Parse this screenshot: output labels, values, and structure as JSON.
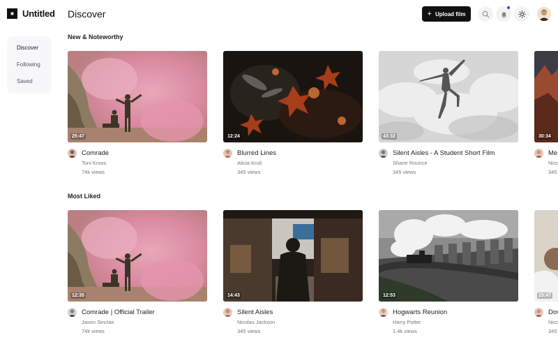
{
  "app": {
    "name": "Untitled"
  },
  "sidebar": {
    "items": [
      {
        "label": "Discover",
        "active": true
      },
      {
        "label": "Following",
        "active": false
      },
      {
        "label": "Saved",
        "active": false
      }
    ]
  },
  "header": {
    "title": "Discover",
    "upload_label": "Upload film",
    "icons": [
      "search-icon",
      "bell-icon",
      "sun-icon"
    ],
    "notification_dot_color": "#6b2bd9"
  },
  "sections": [
    {
      "title": "New & Noteworthy",
      "films": [
        {
          "title": "Comrade",
          "author": "Toni Kroos",
          "views": "74k views",
          "duration": "25:47",
          "thumb": "smoke-soldiers"
        },
        {
          "title": "Blurred Lines",
          "author": "Alicia Krull",
          "views": "345 views",
          "duration": "12:24",
          "thumb": "autumn-leaves"
        },
        {
          "title": "Silent Aisles - A Student Short Film",
          "author": "Shane Rounce",
          "views": "345 views",
          "duration": "43:32",
          "thumb": "cloud-jumper"
        },
        {
          "title": "Mem",
          "author": "Nico",
          "views": "345",
          "duration": "30:34",
          "thumb": "red-rocks"
        }
      ]
    },
    {
      "title": "Most Liked",
      "films": [
        {
          "title": "Comrade | Official Trailer",
          "author": "Jason Sinclair",
          "views": "74k views",
          "duration": "12:35",
          "thumb": "smoke-soldiers"
        },
        {
          "title": "Silent Aisles",
          "author": "Nicolas Jackson",
          "views": "345 views",
          "duration": "14:43",
          "thumb": "market-alley"
        },
        {
          "title": "Hogwarts Reunion",
          "author": "Harry Potter",
          "views": "1.4k views",
          "duration": "12:53",
          "thumb": "steam-train"
        },
        {
          "title": "Dov",
          "author": "Nico",
          "views": "345",
          "duration": "25:47",
          "thumb": "portrait"
        }
      ]
    }
  ]
}
